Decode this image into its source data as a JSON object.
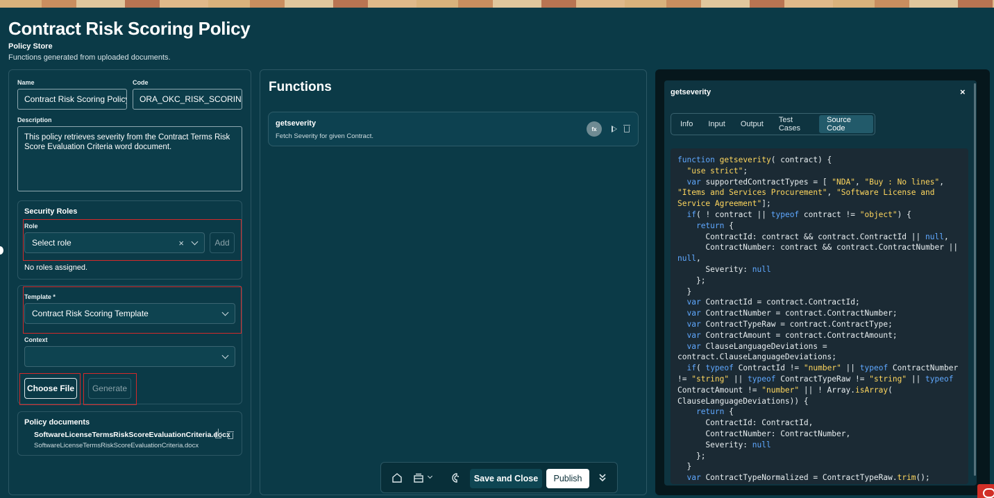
{
  "header": {
    "title": "Contract Risk Scoring Policy",
    "subtitle": "Policy Store",
    "description": "Functions generated from uploaded documents."
  },
  "form": {
    "name_label": "Name",
    "name_value": "Contract Risk Scoring Policy",
    "code_label": "Code",
    "code_value": "ORA_OKC_RISK_SCORING_PO",
    "description_label": "Description",
    "description_value": "This policy retrieves severity from the Contract Terms Risk Score Evaluation Criteria word document."
  },
  "security": {
    "title": "Security Roles",
    "role_label": "Role",
    "role_placeholder": "Select role",
    "add_label": "Add",
    "empty_text": "No roles assigned."
  },
  "template": {
    "label": "Template *",
    "value": "Contract Risk Scoring Template",
    "context_label": "Context",
    "context_value": "",
    "choose_file_label": "Choose File",
    "generate_label": "Generate"
  },
  "documents": {
    "title": "Policy documents",
    "items": [
      {
        "name": "SoftwareLicenseTermsRiskScoreEvaluationCriteria.docx",
        "file": "SoftwareLicenseTermsRiskScoreEvaluationCriteria.docx"
      }
    ]
  },
  "functions": {
    "title": "Functions",
    "items": [
      {
        "name": "getseverity",
        "description": "Fetch Severity for given Contract.",
        "badge": "fx"
      }
    ]
  },
  "toolbar": {
    "save_label": "Save and Close",
    "publish_label": "Publish"
  },
  "detail": {
    "title": "getseverity",
    "close": "×",
    "tabs": [
      "Info",
      "Input",
      "Output",
      "Test Cases",
      "Source Code"
    ],
    "active_tab": "Source Code"
  },
  "code_lines": [
    "function getseverity( contract) {",
    "  \"use strict\";",
    "  var supportedContractTypes = [ \"NDA\", \"Buy : No lines\", \"Items and Services Procurement\", \"Software License and Service Agreement\"];",
    "  if( ! contract || typeof contract != \"object\") {",
    "    return {",
    "      ContractId: contract && contract.ContractId || null,",
    "      ContractNumber: contract && contract.ContractNumber || null,",
    "      Severity: null",
    "    };",
    "  }",
    "  var ContractId = contract.ContractId;",
    "  var ContractNumber = contract.ContractNumber;",
    "  var ContractTypeRaw = contract.ContractType;",
    "  var ContractAmount = contract.ContractAmount;",
    "  var ClauseLanguageDeviations = contract.ClauseLanguageDeviations;",
    "  if( typeof ContractId != \"number\" || typeof ContractNumber != \"string\" || typeof ContractTypeRaw != \"string\" || typeof ContractAmount != \"number\" || ! Array.isArray( ClauseLanguageDeviations)) {",
    "    return {",
    "      ContractId: ContractId,",
    "      ContractNumber: ContractNumber,",
    "      Severity: null",
    "    };",
    "  }",
    "  var ContractTypeNormalized = ContractTypeRaw.trim();"
  ],
  "colors": {
    "background": "#0b3a47",
    "highlight_outline": "#d42a2a",
    "code_background": "#1b2a34",
    "keyword": "#5fa8ff",
    "string": "#ffd75e"
  }
}
